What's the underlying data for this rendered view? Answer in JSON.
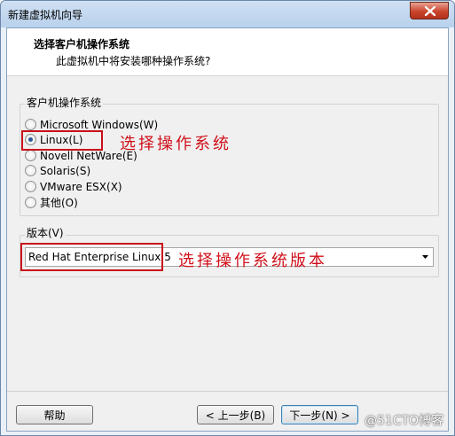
{
  "window": {
    "title": "新建虚拟机向导",
    "close_icon": "close-icon"
  },
  "header": {
    "title": "选择客户机操作系统",
    "subtitle": "此虚拟机中将安装哪种操作系统?"
  },
  "guest_os": {
    "label": "客户机操作系统",
    "selected": "Linux(L)",
    "options": [
      {
        "label": "Microsoft Windows(W)",
        "checked": false
      },
      {
        "label": "Linux(L)",
        "checked": true
      },
      {
        "label": "Novell NetWare(E)",
        "checked": false
      },
      {
        "label": "Solaris(S)",
        "checked": false
      },
      {
        "label": "VMware ESX(X)",
        "checked": false
      },
      {
        "label": "其他(O)",
        "checked": false
      }
    ]
  },
  "version": {
    "label": "版本(V)",
    "selected": "Red Hat Enterprise Linux 5"
  },
  "annotations": {
    "select_os": "选择操作系统",
    "select_version": "选择操作系统版本",
    "color": "#d0101a"
  },
  "buttons": {
    "help": "帮助",
    "back": "< 上一步(B)",
    "next": "下一步(N) >"
  },
  "watermark": "@51CTO博客"
}
